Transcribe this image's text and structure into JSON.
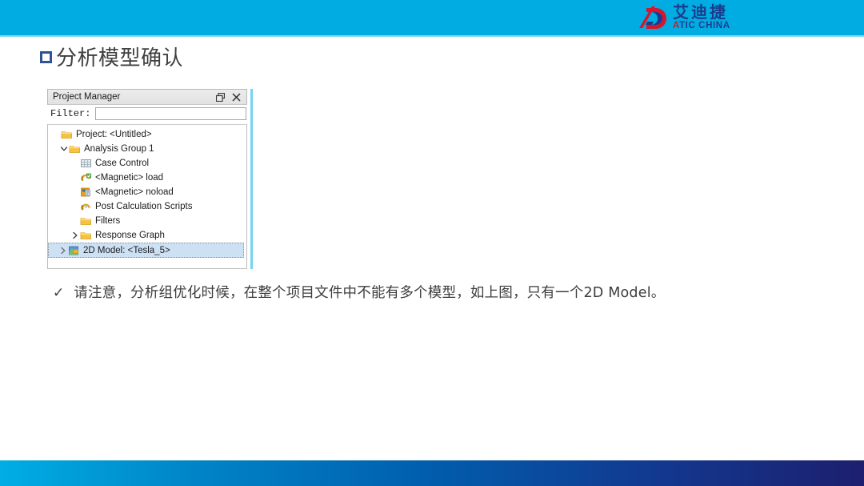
{
  "header": {
    "bar_color": "#00ACE2",
    "logo": {
      "icon": "atic-monogram-icon",
      "chinese_name": "艾迪捷",
      "english_prefix": "A",
      "english_rest": "TIC CHINA",
      "red": "#d8152a",
      "blue": "#1b3c8c"
    }
  },
  "slide": {
    "title": "分析模型确认",
    "bullet_icon": "square-bullet-icon",
    "bullet_color": "#2F5496"
  },
  "project_manager": {
    "title": "Project Manager",
    "restore_icon": "restore-window-icon",
    "close_icon": "close-icon",
    "filter": {
      "label": "Filter:",
      "value": "",
      "placeholder": ""
    },
    "tree": [
      {
        "label": "Project: <Untitled>",
        "icon": "folder-icon",
        "indent": 0,
        "chevron": "none",
        "selected": false
      },
      {
        "label": "Analysis Group 1",
        "icon": "folder-icon",
        "indent": 1,
        "chevron": "down",
        "selected": false
      },
      {
        "label": "Case Control",
        "icon": "grid-table-icon",
        "indent": 2,
        "chevron": "none",
        "selected": false
      },
      {
        "label": "<Magnetic> load",
        "icon": "magnetic-load-icon",
        "indent": 2,
        "chevron": "none",
        "selected": false
      },
      {
        "label": "<Magnetic> noload",
        "icon": "magnetic-noload-icon",
        "indent": 2,
        "chevron": "none",
        "selected": false
      },
      {
        "label": "Post Calculation Scripts",
        "icon": "script-icon",
        "indent": 2,
        "chevron": "none",
        "selected": false
      },
      {
        "label": "Filters",
        "icon": "folder-icon",
        "indent": 2,
        "chevron": "none",
        "selected": false
      },
      {
        "label": "Response Graph",
        "icon": "folder-icon",
        "indent": 2,
        "chevron": "right",
        "selected": false
      },
      {
        "label": "2D Model: <Tesla_5>",
        "icon": "model-2d-icon",
        "indent": 1,
        "chevron": "right",
        "selected": true
      }
    ]
  },
  "body": {
    "bullet": "✓",
    "text": "请注意，分析组优化时候，在整个项目文件中不能有多个模型，如上图，只有一个2D Model。"
  },
  "footer": {
    "gradient_start": "#00ADE4",
    "gradient_end": "#1D1F6E"
  }
}
